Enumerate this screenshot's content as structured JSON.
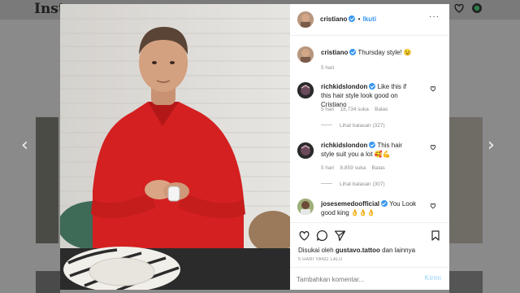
{
  "background": {
    "logo_text": "Insta"
  },
  "post": {
    "author": "cristiano",
    "follow_label": "Ikuti",
    "separator": "•",
    "caption": "Thursday style! 😉",
    "caption_age": "5 hari"
  },
  "comments": [
    {
      "user": "richkidslondon",
      "text": "Like this if this hair style look good on Cristiano",
      "age": "5 hari",
      "likes": "18,734 suka",
      "reply_label": "Balas",
      "view_replies": "Lihat balasan (327)"
    },
    {
      "user": "richkidslondon",
      "text": "This hair style suit you a lot 🥰💪",
      "age": "5 hari",
      "likes": "8,859 suka",
      "reply_label": "Balas",
      "view_replies": "Lihat balasan (307)"
    },
    {
      "user": "josesemedoofficial",
      "text": "You Look good king 👌👌👌"
    }
  ],
  "likes_summary": {
    "prefix": "Disukai oleh",
    "user": "gustavo.tattoo",
    "suffix": "dan lainnya"
  },
  "timestamp": "5 HARI YANG LALU",
  "comment_box": {
    "placeholder": "Tambahkan komentar...",
    "submit_label": "Kirim"
  },
  "colors": {
    "accent": "#3897f0",
    "shirt": "#d42020",
    "muted": "#8e8e8e"
  },
  "icons": [
    "more-options-icon",
    "heart-icon",
    "comment-icon",
    "share-icon",
    "bookmark-icon",
    "chevron-left-icon",
    "chevron-right-icon",
    "compass-icon"
  ]
}
